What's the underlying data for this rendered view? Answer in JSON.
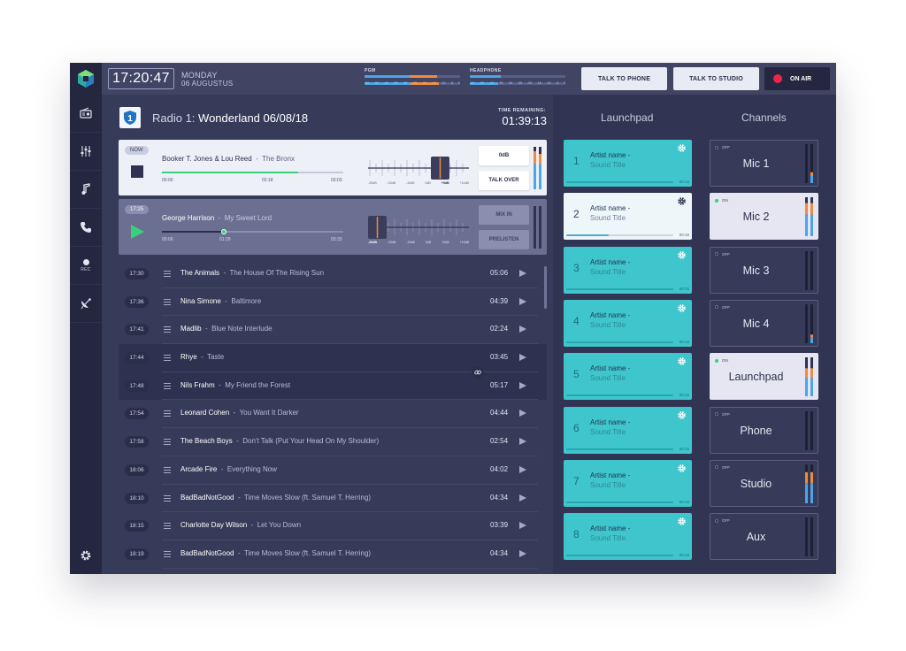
{
  "header": {
    "clock": "17:20:47",
    "day": "MONDAY",
    "date": "06 AUGUSTUS",
    "meters": [
      {
        "label": "PGM",
        "levels": [
          0.76,
          0.78
        ],
        "ticks": [
          "-60",
          "-50",
          "-40",
          "-35",
          "-30",
          "-25",
          "-20",
          "-15",
          "-10",
          "-5",
          "0"
        ]
      },
      {
        "label": "HEADPHONE",
        "levels": [
          0.32,
          0.3
        ],
        "ticks": [
          "-60",
          "-50",
          "-40",
          "-35",
          "-30",
          "-25",
          "-20",
          "-15",
          "-10",
          "-5",
          "0"
        ]
      }
    ],
    "talk_phone": "TALK TO PHONE",
    "talk_studio": "TALK TO STUDIO",
    "on_air": "ON AIR"
  },
  "show": {
    "badge": "1",
    "prefix": "Radio 1: ",
    "name": "Wonderland 06/08/18",
    "time_remaining_label": "TIME REMAINING:",
    "time_remaining": "01:39:13"
  },
  "now_playing": {
    "badge": "NOW",
    "artist": "Booker T. Jones & Lou Reed",
    "title": "The Bronx",
    "start": "00:00",
    "position": "02:18",
    "end": "03:03",
    "progress": 0.75,
    "fader_labels": [
      "-30dB",
      "-20dB",
      "-15dB",
      "0dB",
      "+5dB",
      "+10dB"
    ],
    "fader_level": "+5dB",
    "btn_top": "0dB",
    "btn_bottom": "TALK OVER"
  },
  "next_up": {
    "badge": "17:25",
    "artist": "George Harrison",
    "title": "My Sweet Lord",
    "start": "00:00",
    "position": "01:29",
    "end": "03:33",
    "progress": 0.34,
    "fader_labels": [
      "-30dB",
      "-20dB",
      "-15dB",
      "0dB",
      "+5dB",
      "+10dB"
    ],
    "fader_level": "-30dB",
    "btn_top": "MIX IN",
    "btn_bottom": "PRELISTEN"
  },
  "playlist": [
    {
      "time": "17:30",
      "artist": "The Animals",
      "title": "The House Of The Rising Sun",
      "duration": "05:06"
    },
    {
      "time": "17:36",
      "artist": "Nina Simone",
      "title": "Baltimore",
      "duration": "04:39"
    },
    {
      "time": "17:41",
      "artist": "Madlib",
      "title": "Blue Note Interlude",
      "duration": "02:24"
    },
    {
      "time": "17:44",
      "artist": "Rhye",
      "title": "Taste",
      "duration": "03:45"
    },
    {
      "time": "17:48",
      "artist": "Nils Frahm",
      "title": "My Friend the Forest",
      "duration": "05:17"
    },
    {
      "time": "17:54",
      "artist": "Leonard Cohen",
      "title": "You Want It Darker",
      "duration": "04:44"
    },
    {
      "time": "17:58",
      "artist": "The Beach Boys",
      "title": "Don't Talk (Put Your Head On My Shoulder)",
      "duration": "02:54"
    },
    {
      "time": "18:06",
      "artist": "Arcade Fire",
      "title": "Everything Now",
      "duration": "04:02"
    },
    {
      "time": "18:10",
      "artist": "BadBadNotGood",
      "title": "Time Moves Slow (ft. Samuel T. Herring)",
      "duration": "04:34"
    },
    {
      "time": "18:15",
      "artist": "Charlotte Day Wilson",
      "title": "Let You Down",
      "duration": "03:39"
    },
    {
      "time": "18:19",
      "artist": "BadBadNotGood",
      "title": "Time Moves Slow (ft. Samuel T. Herring)",
      "duration": "04:34"
    }
  ],
  "launchpad": {
    "title": "Launchpad",
    "pads": [
      {
        "num": "1",
        "artist": "Artist name -",
        "song": "Sound Title",
        "time": "00:16",
        "active": false,
        "progress": 0
      },
      {
        "num": "2",
        "artist": "Artist name -",
        "song": "Sound Title",
        "time": "00:16",
        "active": true,
        "progress": 0.4
      },
      {
        "num": "3",
        "artist": "Artist name -",
        "song": "Sound Title",
        "time": "00:16",
        "active": false,
        "progress": 0
      },
      {
        "num": "4",
        "artist": "Artist name -",
        "song": "Sound Title",
        "time": "00:16",
        "active": false,
        "progress": 0
      },
      {
        "num": "5",
        "artist": "Artist name -",
        "song": "Sound Title",
        "time": "00:16",
        "active": false,
        "progress": 0
      },
      {
        "num": "6",
        "artist": "Artist name -",
        "song": "Sound Title",
        "time": "00:16",
        "active": false,
        "progress": 0
      },
      {
        "num": "7",
        "artist": "Artist name -",
        "song": "Sound Title",
        "time": "00:16",
        "active": false,
        "progress": 0
      },
      {
        "num": "8",
        "artist": "Artist name -",
        "song": "Sound Title",
        "time": "00:16",
        "active": false,
        "progress": 0
      }
    ]
  },
  "channels": {
    "title": "Channels",
    "items": [
      {
        "name": "Mic 1",
        "state": "OFF",
        "on": false,
        "levels": [
          0.0,
          0.28
        ]
      },
      {
        "name": "Mic 2",
        "state": "ON",
        "on": true,
        "levels": [
          0.85,
          0.85
        ]
      },
      {
        "name": "Mic 3",
        "state": "OFF",
        "on": false,
        "levels": [
          0.0,
          0.0
        ]
      },
      {
        "name": "Mic 4",
        "state": "OFF",
        "on": false,
        "levels": [
          0.0,
          0.22
        ]
      },
      {
        "name": "Launchpad",
        "state": "ON",
        "on": true,
        "levels": [
          0.72,
          0.72
        ]
      },
      {
        "name": "Phone",
        "state": "OFF",
        "on": false,
        "levels": [
          0.0,
          0.0
        ]
      },
      {
        "name": "Studio",
        "state": "OFF",
        "on": false,
        "levels": [
          0.8,
          0.8
        ]
      },
      {
        "name": "Aux",
        "state": "OFF",
        "on": false,
        "levels": [
          0.0,
          0.0
        ]
      }
    ]
  },
  "sidebar": {
    "rec_label": "REC"
  },
  "colors": {
    "accent_green": "#38d07a",
    "accent_teal": "#3fc5cc",
    "on_air_red": "#e8264c",
    "vu_orange": "#f08a3c",
    "vu_blue": "#4aa6e8"
  }
}
